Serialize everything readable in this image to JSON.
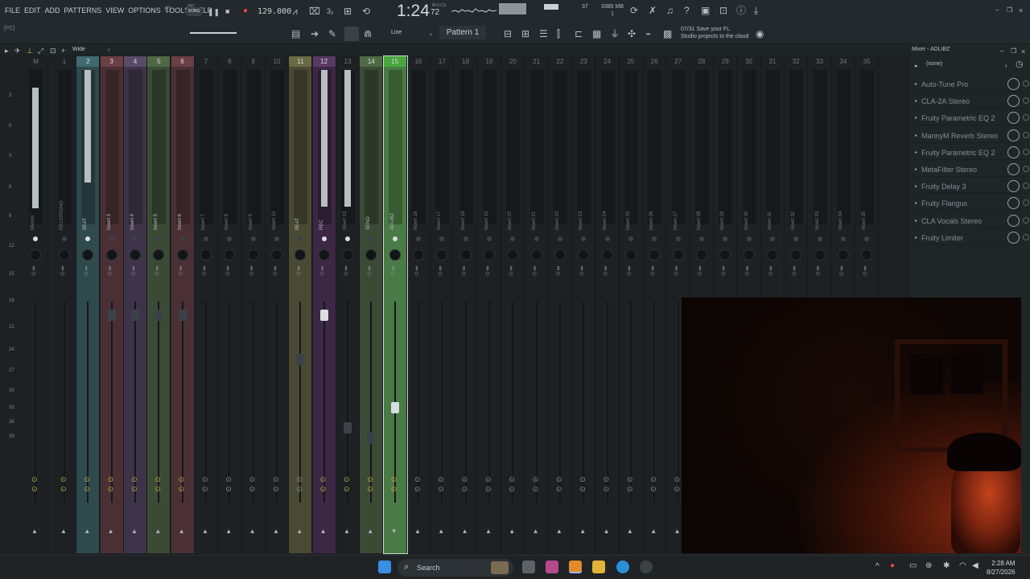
{
  "menu": [
    "FILE",
    "EDIT",
    "ADD",
    "PATTERNS",
    "VIEW",
    "OPTIONS",
    "TOOLS",
    "HELP"
  ],
  "transport": {
    "song_mode": "SONG",
    "pat_label": "PAT",
    "bpm": "129.000",
    "time_main": "1:24",
    "time_frac": "72",
    "time_label": "M:S:CS"
  },
  "monitor": {
    "cpu": "37",
    "memory_mb": "3385 MB",
    "polyphony": "1"
  },
  "toolbar2": {
    "pc_label": "[PC]",
    "snap_mode": "Line",
    "pattern": "Pattern 1",
    "news_line1": "07/31  Save your FL",
    "news_line2": "Studio projects to the cloud"
  },
  "viewbar": {
    "view_mode": "Wide"
  },
  "scale": [
    "3",
    "0",
    "3",
    "6",
    "9",
    "12",
    "15",
    "18",
    "21",
    "24",
    "27",
    "30",
    "33",
    "36",
    "39"
  ],
  "mixer": {
    "strips": [
      {
        "num": "M",
        "name": "Master"
      },
      {
        "num": "1",
        "name": "RECORDING"
      },
      {
        "num": "2",
        "name": "BEAT"
      },
      {
        "num": "3",
        "name": "Insert 3"
      },
      {
        "num": "4",
        "name": "Insert 4"
      },
      {
        "num": "5",
        "name": "Insert 5"
      },
      {
        "num": "6",
        "name": "Insert 6"
      },
      {
        "num": "7",
        "name": "Insert 7"
      },
      {
        "num": "8",
        "name": "Insert 8"
      },
      {
        "num": "9",
        "name": "Insert 9"
      },
      {
        "num": "10",
        "name": "Insert 10"
      },
      {
        "num": "11",
        "name": "BEAT"
      },
      {
        "num": "12",
        "name": "REC"
      },
      {
        "num": "13",
        "name": "Insert 13"
      },
      {
        "num": "14",
        "name": "SEND"
      },
      {
        "num": "15",
        "name": "ADLIBZ"
      },
      {
        "num": "16",
        "name": "Insert 16"
      },
      {
        "num": "17",
        "name": "Insert 17"
      },
      {
        "num": "18",
        "name": "Insert 18"
      },
      {
        "num": "19",
        "name": "Insert 19"
      },
      {
        "num": "20",
        "name": "Insert 20"
      },
      {
        "num": "21",
        "name": "Insert 21"
      },
      {
        "num": "22",
        "name": "Insert 22"
      },
      {
        "num": "23",
        "name": "Insert 23"
      },
      {
        "num": "24",
        "name": "Insert 24"
      },
      {
        "num": "25",
        "name": "Insert 25"
      },
      {
        "num": "26",
        "name": "Insert 26"
      },
      {
        "num": "27",
        "name": "Insert 27"
      },
      {
        "num": "28",
        "name": "Insert 28"
      },
      {
        "num": "29",
        "name": "Insert 29"
      },
      {
        "num": "30",
        "name": "Insert 30"
      },
      {
        "num": "31",
        "name": "Insert 31"
      },
      {
        "num": "32",
        "name": "Insert 32"
      },
      {
        "num": "33",
        "name": "Insert 33"
      },
      {
        "num": "34",
        "name": "Insert 34"
      },
      {
        "num": "35",
        "name": "Insert 35"
      }
    ]
  },
  "fx_panel": {
    "title": "Mixer - ADLIBZ",
    "input": "(none)",
    "slots": [
      "Auto-Tune Pro",
      "CLA-2A Stereo",
      "Fruity Parametric EQ 2",
      "MannyM Reverb Stereo",
      "Fruity Parametric EQ 2",
      "MetaFilter Stereo",
      "Fruity Delay 3",
      "Fruity Flangus",
      "CLA Vocals Stereo",
      "Fruity Limiter"
    ]
  },
  "taskbar": {
    "search_label": "Search",
    "time": "2:28 AM",
    "date": "8/27/2026"
  },
  "colors": {
    "selected_strip": "#4a7a45",
    "teal_strip": "#2f4a4d",
    "red_strip": "#4a3035",
    "purple_strip": "#3e3449",
    "green_strip": "#3b4a34",
    "olive_strip": "#4a4a34",
    "rec_strip": "#3d2744"
  }
}
